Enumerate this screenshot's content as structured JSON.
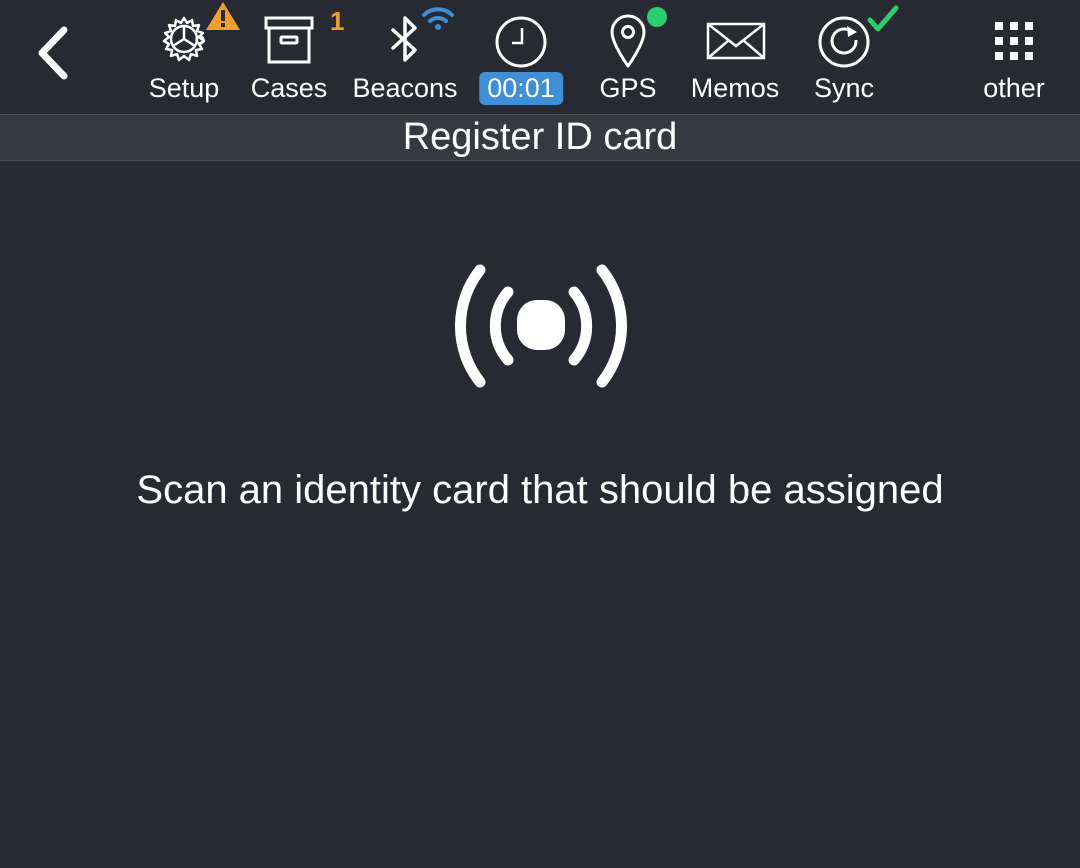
{
  "toolbar": {
    "back_icon": "chevron-left-icon",
    "items": [
      {
        "id": "setup",
        "label": "Setup",
        "icon": "gear-icon",
        "badge_icon": "warning-icon",
        "badge_color": "#f0a030"
      },
      {
        "id": "cases",
        "label": "Cases",
        "icon": "archive-box-icon",
        "count": "1",
        "count_color": "#f0a030"
      },
      {
        "id": "beacons",
        "label": "Beacons",
        "icon": "bluetooth-icon",
        "badge_icon": "wifi-signal-icon",
        "badge_color": "#3f8fd6"
      },
      {
        "id": "timer",
        "label": "00:01",
        "icon": "clock-icon",
        "badge_color": "#3f8fd6"
      },
      {
        "id": "gps",
        "label": "GPS",
        "icon": "location-pin-icon",
        "badge_icon": "status-dot-icon",
        "badge_color": "#2ecc71"
      },
      {
        "id": "memos",
        "label": "Memos",
        "icon": "envelope-icon"
      },
      {
        "id": "sync",
        "label": "Sync",
        "icon": "sync-icon",
        "badge_icon": "checkmark-icon",
        "badge_color": "#2ecc71"
      },
      {
        "id": "other",
        "label": "other",
        "icon": "grid-menu-icon"
      }
    ]
  },
  "page": {
    "title": "Register ID card",
    "scan_icon": "nfc-broadcast-icon",
    "instruction": "Scan an identity card that should be assigned"
  },
  "colors": {
    "background": "#272a33",
    "title_bar": "#353942",
    "accent_blue": "#3f8fd6",
    "warning_orange": "#f0a030",
    "success_green": "#2ecc71"
  }
}
